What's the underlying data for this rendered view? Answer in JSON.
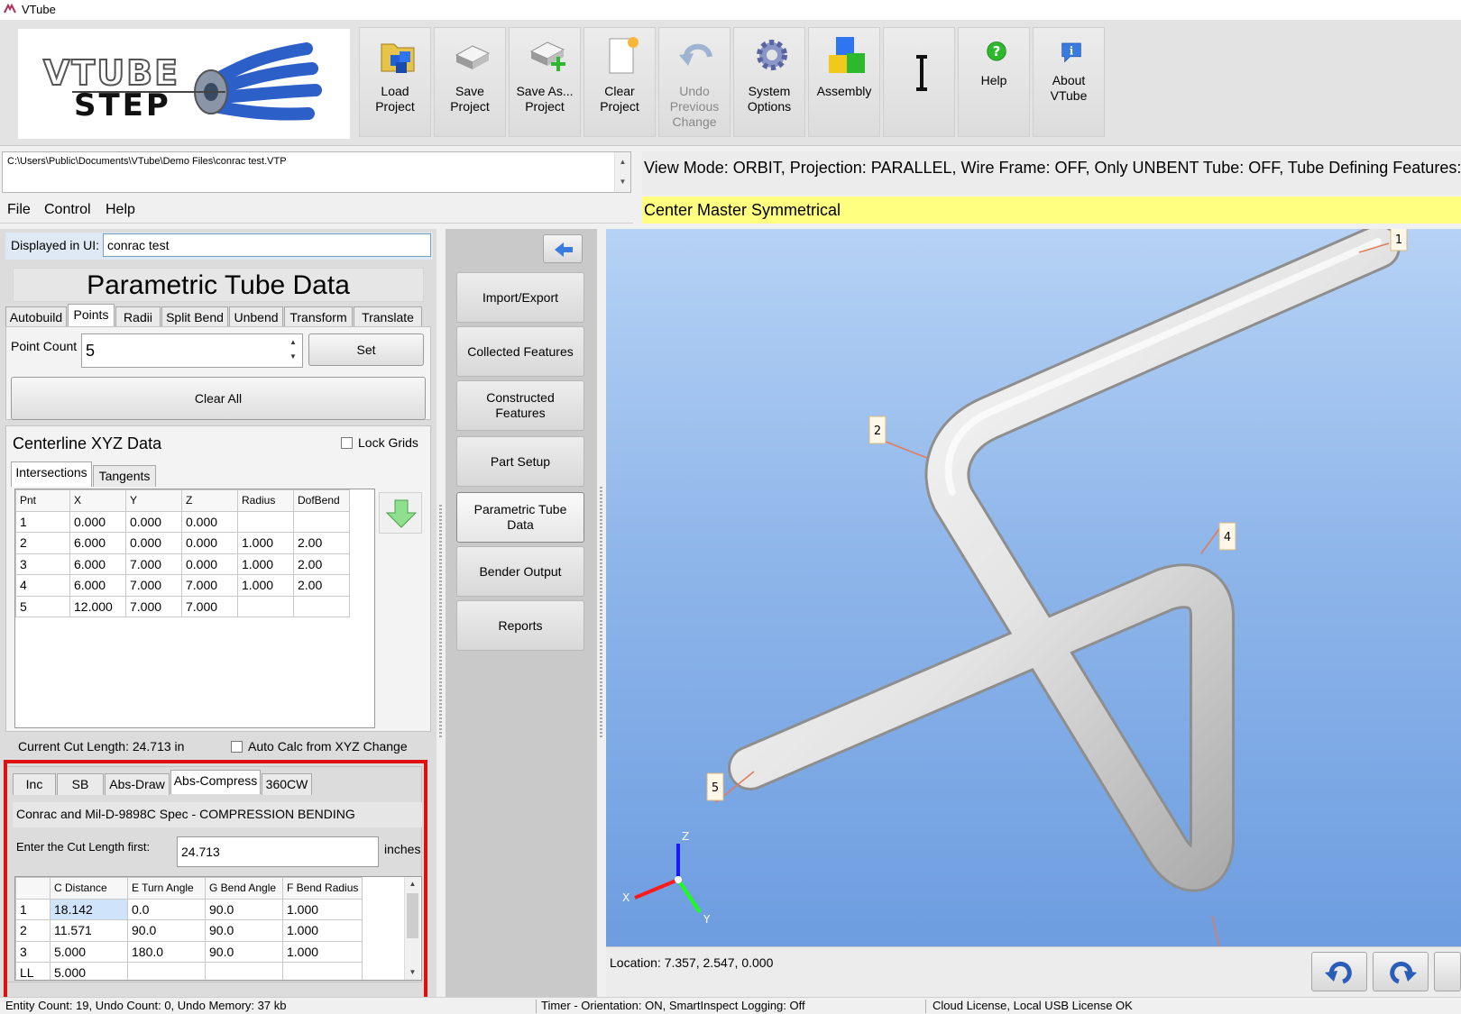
{
  "window": {
    "title": "VTube"
  },
  "toolbar": {
    "logo_text_top": "VTUBE",
    "logo_text_bottom": "STEP",
    "buttons": [
      {
        "label": "Load\nProject",
        "icon": "folder-cubes-icon"
      },
      {
        "label": "Save\nProject",
        "icon": "save-drive-icon"
      },
      {
        "label": "Save As...\nProject",
        "icon": "save-as-drive-icon"
      },
      {
        "label": "Clear\nProject",
        "icon": "new-page-icon"
      },
      {
        "label": "Undo\nPrevious\nChange",
        "icon": "undo-arrow-icon",
        "disabled": true
      },
      {
        "label": "System\nOptions",
        "icon": "gear-icon"
      },
      {
        "label": "Assembly",
        "icon": "cubes-icon"
      },
      {
        "label": "",
        "icon": "text-cursor-icon"
      },
      {
        "label": "Help",
        "icon": "help-icon"
      },
      {
        "label": "About\nVTube",
        "icon": "info-icon"
      }
    ]
  },
  "file_path": "C:\\Users\\Public\\Documents\\VTube\\Demo Files\\conrac test.VTP",
  "menu": [
    "File",
    "Control",
    "Help"
  ],
  "view_mode_text": "View Mode: ORBIT, Projection: PARALLEL, Wire Frame: OFF, Only UNBENT Tube: OFF, Tube Defining Features:",
  "part_label": "Center Master Symmetrical",
  "left": {
    "displayed_label": "Displayed in UI:",
    "displayed_value": "conrac test",
    "panel_title": "Parametric Tube Data",
    "tabs": [
      "Autobuild",
      "Points",
      "Radii",
      "Split Bend",
      "Unbend",
      "Transform",
      "Translate"
    ],
    "active_tab": "Points",
    "point_count_label": "Point Count",
    "point_count_value": "5",
    "set_label": "Set",
    "clear_all_label": "Clear All",
    "xyz_title": "Centerline XYZ Data",
    "lock_grids_label": "Lock Grids",
    "xyz_tabs": [
      "Intersections",
      "Tangents"
    ],
    "xyz_columns": [
      "Pnt",
      "X",
      "Y",
      "Z",
      "Radius",
      "DofBend"
    ],
    "xyz_rows": [
      [
        "1",
        "0.000",
        "0.000",
        "0.000",
        "",
        ""
      ],
      [
        "2",
        "6.000",
        "0.000",
        "0.000",
        "1.000",
        "2.00"
      ],
      [
        "3",
        "6.000",
        "7.000",
        "0.000",
        "1.000",
        "2.00"
      ],
      [
        "4",
        "6.000",
        "7.000",
        "7.000",
        "1.000",
        "2.00"
      ],
      [
        "5",
        "12.000",
        "7.000",
        "7.000",
        "",
        ""
      ]
    ],
    "current_cut_length": "Current Cut Length:  24.713 in",
    "auto_calc_label": "Auto Calc from XYZ Change",
    "bend_tabs": [
      "Inc",
      "SB",
      "Abs-Draw",
      "Abs-Compress",
      "360CW"
    ],
    "active_bend_tab": "Abs-Compress",
    "spec_label": "Conrac and Mil-D-9898C Spec - COMPRESSION BENDING",
    "enter_cut_label": "Enter the Cut Length first:",
    "cut_value": "24.713",
    "inches_label": "inches",
    "abs_columns": [
      "",
      "C Distance",
      "E Turn Angle",
      "G Bend Angle",
      "F Bend Radius"
    ],
    "abs_rows": [
      [
        "1",
        "18.142",
        "0.0",
        "90.0",
        "1.000"
      ],
      [
        "2",
        "11.571",
        "90.0",
        "90.0",
        "1.000"
      ],
      [
        "3",
        "5.000",
        "180.0",
        "90.0",
        "1.000"
      ],
      [
        "LL",
        "5.000",
        "",
        "",
        ""
      ]
    ]
  },
  "nav": {
    "buttons": [
      "Import/Export",
      "Collected Features",
      "Constructed\nFeatures",
      "Part Setup",
      "Parametric Tube\nData",
      "Bender Output",
      "Reports"
    ],
    "active": "Parametric Tube\nData"
  },
  "viewport": {
    "point_labels": [
      "1",
      "2",
      "4",
      "5"
    ],
    "axis_labels": {
      "x": "X",
      "y": "Y",
      "z": "Z"
    },
    "location": "Location: 7.357, 2.547, 0.000"
  },
  "status": {
    "left": "Entity Count: 19, Undo Count: 0, Undo Memory: 37 kb",
    "middle": "Timer - Orientation: ON, SmartInspect Logging: Off",
    "right": "Cloud License, Local USB License OK"
  }
}
